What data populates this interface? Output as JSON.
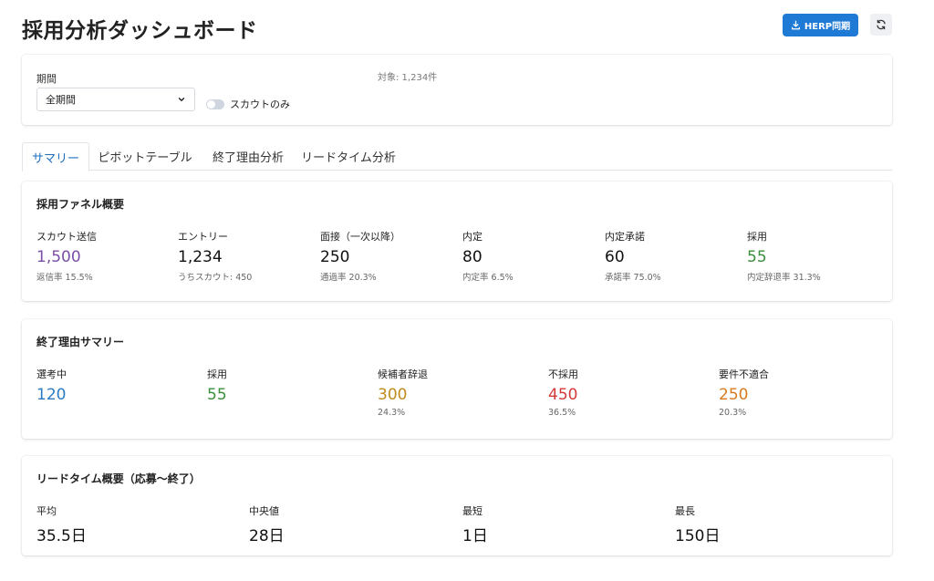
{
  "header": {
    "title": "採用分析ダッシュボード",
    "sync_label": "HERP同期"
  },
  "filters": {
    "period_label": "期間",
    "period_value": "全期間",
    "scout_only_label": "スカウトのみ",
    "scout_only_on": false,
    "count_text": "対象: 1,234件"
  },
  "tabs": [
    "サマリー",
    "ピボットテーブル",
    "終了理由分析",
    "リードタイム分析"
  ],
  "funnel": {
    "title": "採用ファネル概要",
    "metrics": [
      {
        "label": "スカウト送信",
        "value": "1,500",
        "sub": "返信率 15.5%",
        "color": "#7b4fa8"
      },
      {
        "label": "エントリー",
        "value": "1,234",
        "sub": "うちスカウト: 450",
        "color": "#111111"
      },
      {
        "label": "面接（一次以降）",
        "value": "250",
        "sub": "通過率 20.3%",
        "color": "#111111"
      },
      {
        "label": "内定",
        "value": "80",
        "sub": "内定率 6.5%",
        "color": "#111111"
      },
      {
        "label": "内定承諾",
        "value": "60",
        "sub": "承諾率 75.0%",
        "color": "#111111"
      },
      {
        "label": "採用",
        "value": "55",
        "sub": "内定辞退率 31.3%",
        "color": "#3a8f3a"
      }
    ]
  },
  "reasons": {
    "title": "終了理由サマリー",
    "metrics": [
      {
        "label": "選考中",
        "value": "120",
        "sub": "",
        "color": "#2b7cc4"
      },
      {
        "label": "採用",
        "value": "55",
        "sub": "",
        "color": "#3a8f3a"
      },
      {
        "label": "候補者辞退",
        "value": "300",
        "sub": "24.3%",
        "color": "#c08a1e"
      },
      {
        "label": "不採用",
        "value": "450",
        "sub": "36.5%",
        "color": "#d33a3a"
      },
      {
        "label": "要件不適合",
        "value": "250",
        "sub": "20.3%",
        "color": "#d97a1f"
      }
    ]
  },
  "leadtime": {
    "title": "リードタイム概要（応募〜終了）",
    "metrics": [
      {
        "label": "平均",
        "value": "35.5日"
      },
      {
        "label": "中央値",
        "value": "28日"
      },
      {
        "label": "最短",
        "value": "1日"
      },
      {
        "label": "最長",
        "value": "150日"
      }
    ]
  }
}
